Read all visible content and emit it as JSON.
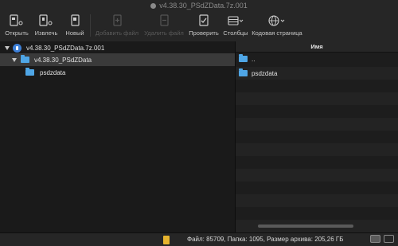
{
  "window": {
    "title": "v4.38.30_PSdZData.7z.001"
  },
  "toolbar": [
    {
      "label": "Открыть",
      "icon": "open-archive-icon",
      "enabled": true
    },
    {
      "label": "Извлечь",
      "icon": "extract-icon",
      "enabled": true
    },
    {
      "label": "Новый",
      "icon": "new-archive-icon",
      "enabled": true
    },
    {
      "label": "Добавить файл",
      "icon": "add-file-icon",
      "enabled": false
    },
    {
      "label": "Удалить файл",
      "icon": "delete-file-icon",
      "enabled": false
    },
    {
      "label": "Проверить",
      "icon": "test-archive-icon",
      "enabled": true
    },
    {
      "label": "Столбцы",
      "icon": "columns-icon",
      "enabled": true
    },
    {
      "label": "Кодовая страница",
      "icon": "globe-icon",
      "enabled": true
    }
  ],
  "tree": [
    {
      "label": "v4.38.30_PSdZData.7z.001",
      "icon": "archive-icon",
      "expanded": true
    },
    {
      "label": "v4.38.30_PSdZData",
      "icon": "folder-icon",
      "expanded": true,
      "selected": true
    },
    {
      "label": "psdzdata",
      "icon": "folder-icon",
      "expanded": false
    }
  ],
  "filelist": {
    "column_header": "Имя",
    "rows": [
      {
        "name": "..",
        "icon": "folder-icon"
      },
      {
        "name": "psdzdata",
        "icon": "folder-icon"
      }
    ]
  },
  "statusbar": {
    "text": "Файл: 85709, Папка: 1095, Размер архива: 205,26 ГБ",
    "icon": "zip-archive-icon"
  },
  "colors": {
    "folder": "#4fa6e6",
    "archive": "#3d7fd6",
    "zip": "#e6b32e"
  }
}
